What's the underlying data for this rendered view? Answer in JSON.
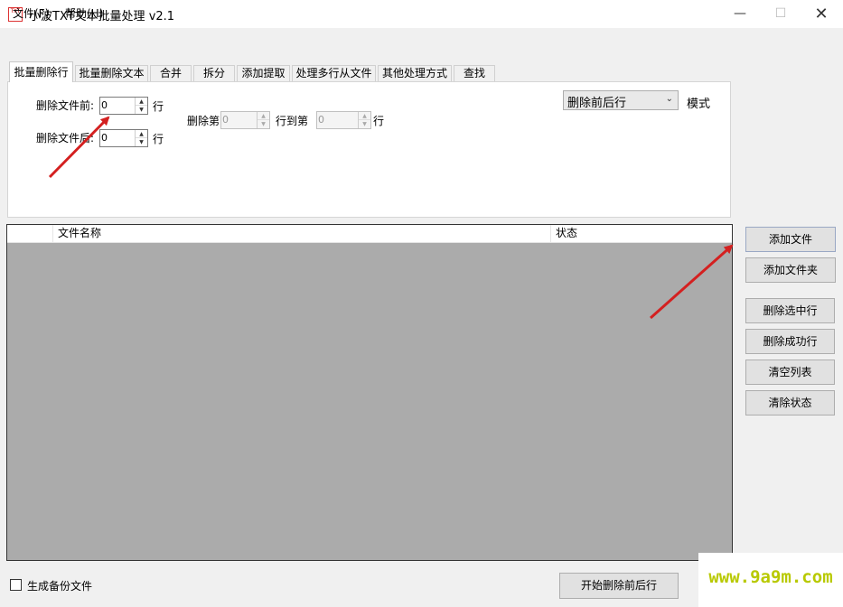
{
  "window": {
    "icon_text": "TXT",
    "title": "小波TXT文本批量处理 v2.1",
    "min_glyph": "—",
    "max_glyph": "☐",
    "close_glyph": "✕"
  },
  "menu": {
    "file": "文件(F)",
    "help": "帮助(H)"
  },
  "tabs": [
    {
      "label": "批量删除行",
      "active": true
    },
    {
      "label": "批量删除文本"
    },
    {
      "label": "合并"
    },
    {
      "label": "拆分"
    },
    {
      "label": "添加提取"
    },
    {
      "label": "处理多行从文件"
    },
    {
      "label": "其他处理方式"
    },
    {
      "label": "查找"
    }
  ],
  "panel": {
    "delete_before_label": "删除文件前:",
    "delete_before_value": "0",
    "delete_after_label": "删除文件后:",
    "delete_after_value": "0",
    "line_unit": "行",
    "delete_nth_label": "删除第",
    "delete_nth_value": "0",
    "to_line_label": "行到第",
    "to_line_value": "0",
    "mode_value": "删除前后行",
    "mode_label": "模式",
    "spin_up": "▲",
    "spin_down": "▼",
    "dropdown_arrow": "⌄"
  },
  "list": {
    "columns": [
      "",
      "文件名称",
      "状态"
    ],
    "rows": []
  },
  "buttons": {
    "add_file": "添加文件",
    "add_folder": "添加文件夹",
    "delete_selected": "删除选中行",
    "delete_success": "删除成功行",
    "clear_list": "清空列表",
    "clear_status": "清除状态"
  },
  "bottom": {
    "backup_label": "生成备份文件",
    "backup_checked": false,
    "start_button": "开始删除前后行"
  },
  "watermark": "www.9a9m.com",
  "colors": {
    "list_background": "#ababab",
    "arrow": "#d42020",
    "watermark": "#b8c900"
  }
}
